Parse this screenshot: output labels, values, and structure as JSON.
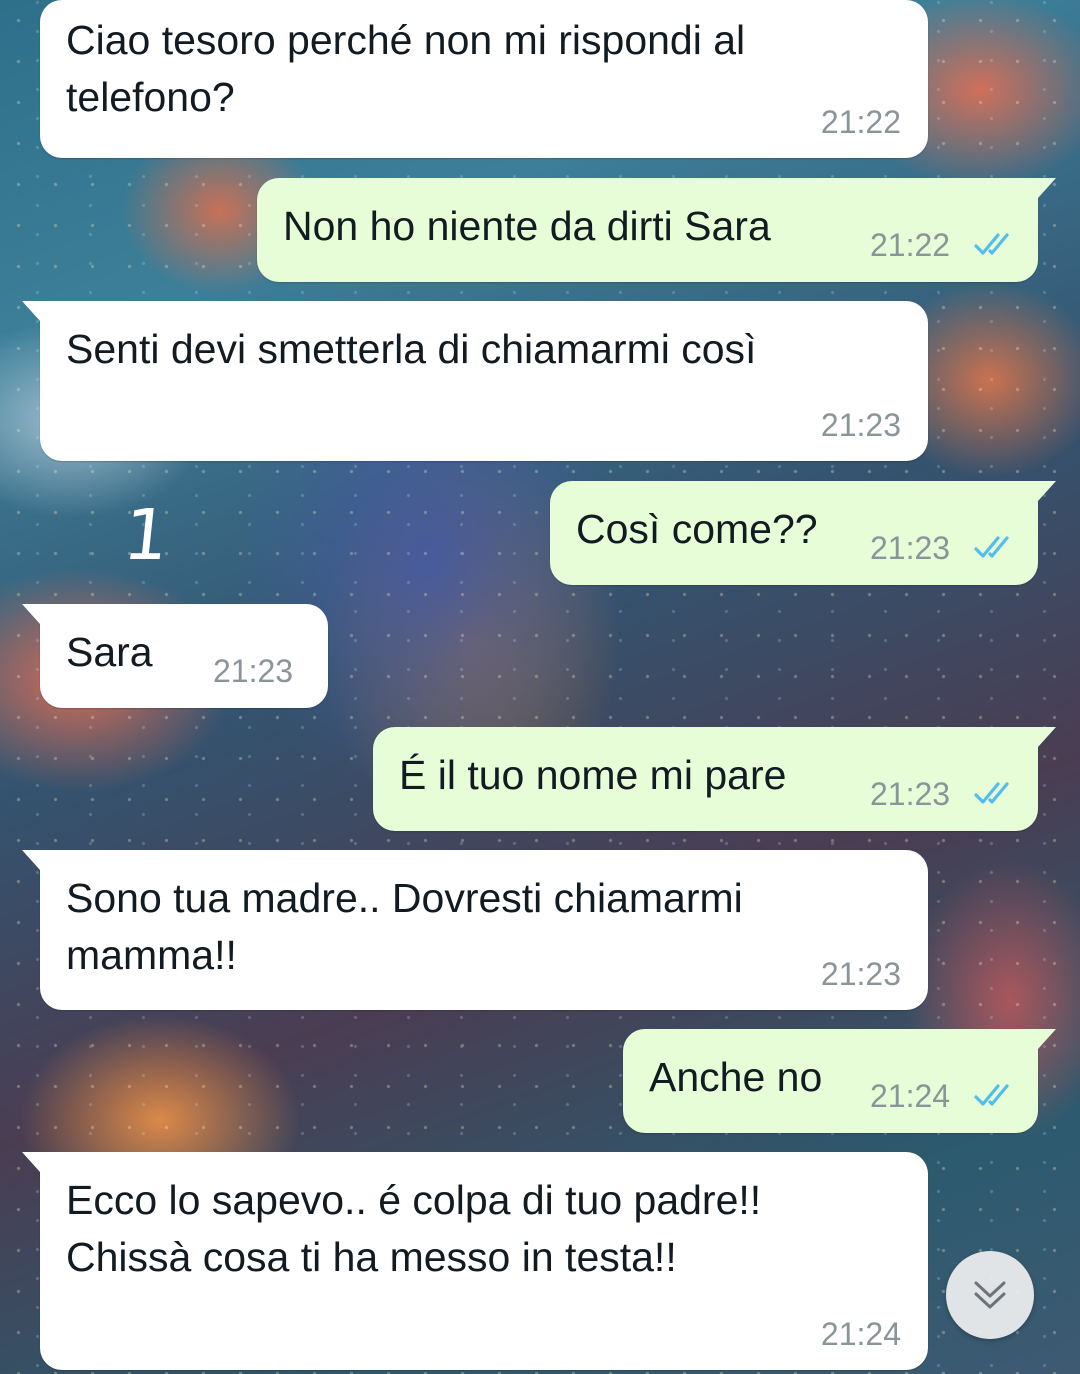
{
  "chat": {
    "annotation": "1",
    "colors": {
      "incoming_bubble": "#ffffff",
      "outgoing_bubble": "#e7fdd8",
      "timestamp": "#8a9599",
      "read_ticks": "#53bdeb"
    },
    "messages": [
      {
        "direction": "in",
        "text": "Ciao tesoro perché non mi rispondi al\ntelefono?",
        "time": "21:22"
      },
      {
        "direction": "out",
        "text": "Non ho niente da dirti Sara",
        "time": "21:22",
        "status": "read"
      },
      {
        "direction": "in",
        "text": "Senti devi smetterla di chiamarmi così",
        "time": "21:23"
      },
      {
        "direction": "out",
        "text": "Così come??",
        "time": "21:23",
        "status": "read"
      },
      {
        "direction": "in",
        "text": "Sara",
        "time": "21:23"
      },
      {
        "direction": "out",
        "text": "É il tuo nome mi pare",
        "time": "21:23",
        "status": "read"
      },
      {
        "direction": "in",
        "text": "Sono tua madre.. Dovresti chiamarmi\nmamma!!",
        "time": "21:23"
      },
      {
        "direction": "out",
        "text": "Anche no",
        "time": "21:24",
        "status": "read"
      },
      {
        "direction": "in",
        "text": "Ecco lo sapevo.. é colpa di tuo padre!!\nChissà cosa ti ha messo in testa!!",
        "time": "21:24"
      }
    ],
    "scroll_button_icon": "double-chevron-down-icon"
  }
}
